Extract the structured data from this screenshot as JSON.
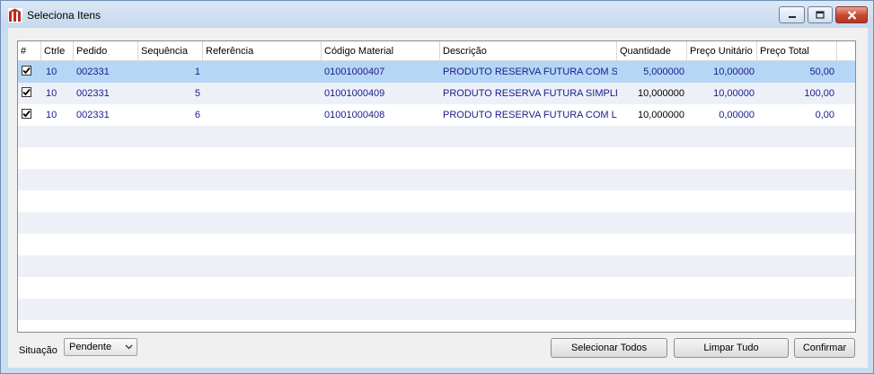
{
  "window": {
    "title": "Seleciona Itens"
  },
  "grid": {
    "columns": [
      "#",
      "Ctrle",
      "Pedido",
      "Sequência",
      "Referência",
      "Código Material",
      "Descrição",
      "Quantidade",
      "Preço Unitário",
      "Preço Total"
    ],
    "rows": [
      {
        "checked": true,
        "ctrle": "10",
        "pedido": "002331",
        "sequencia": "1",
        "referencia": "",
        "codigo": "01001000407",
        "descricao": "PRODUTO RESERVA FUTURA COM SERIE",
        "quantidade": "5,000000",
        "preco_unitario": "10,00000",
        "preco_total": "50,00"
      },
      {
        "checked": true,
        "ctrle": "10",
        "pedido": "002331",
        "sequencia": "5",
        "referencia": "",
        "codigo": "01001000409",
        "descricao": "PRODUTO RESERVA FUTURA SIMPLES C",
        "quantidade": "10,000000",
        "preco_unitario": "10,00000",
        "preco_total": "100,00"
      },
      {
        "checked": true,
        "ctrle": "10",
        "pedido": "002331",
        "sequencia": "6",
        "referencia": "",
        "codigo": "01001000408",
        "descricao": "PRODUTO RESERVA FUTURA  COM LOTE",
        "quantidade": "10,000000",
        "preco_unitario": "0,00000",
        "preco_total": "0,00"
      }
    ]
  },
  "footer": {
    "situacao_label": "Situação",
    "situacao_value": "Pendente",
    "select_all": "Selecionar Todos",
    "clear_all": "Limpar Tudo",
    "confirm": "Confirmar"
  },
  "colors": {
    "selected_row": "#b5d6f5",
    "alt_row": "#edf1f7",
    "cell_text": "#1a1a8c"
  }
}
